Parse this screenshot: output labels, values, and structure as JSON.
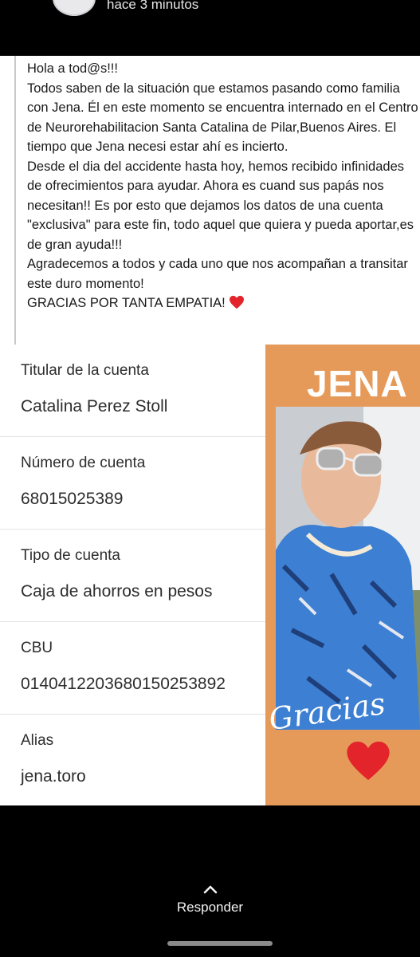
{
  "header": {
    "time_ago": "hace 3 minutos"
  },
  "post": {
    "message": "Hola a tod@s!!!\nTodos saben de la situación que estamos pasando como familia con Jena. Él en este momento se encuentra internado en el Centro de Neurorehabilitacion Santa Catalina de Pilar,Buenos Aires. El tiempo que Jena necesi estar ahí es incierto.\nDesde el dia del accidente hasta hoy, hemos recibido infinidades de ofrecimientos para ayudar. Ahora es cuand sus papás nos necesitan!! Es por esto que dejamos los datos de una cuenta \"exclusiva\" para este fin, todo aquel que quiera y pueda aportar,es de gran ayuda!!!\nAgradecemos a todos y cada uno que nos acompañan a transitar este duro momento!\nGRACIAS POR TANTA EMPATIA!"
  },
  "account": {
    "fields": [
      {
        "label": "Titular de la cuenta",
        "value": "Catalina Perez Stoll"
      },
      {
        "label": "Número de cuenta",
        "value": "68015025389"
      },
      {
        "label": "Tipo de cuenta",
        "value": "Caja de ahorros en pesos"
      },
      {
        "label": "CBU",
        "value": "0140412203680150253892"
      },
      {
        "label": "Alias",
        "value": "jena.toro"
      }
    ]
  },
  "poster": {
    "title": "JENA",
    "signature": "Gracias"
  },
  "footer": {
    "reply_label": "Responder"
  },
  "colors": {
    "poster_orange": "#e69a5a",
    "heart_red": "#e3242b",
    "background": "#000000"
  }
}
